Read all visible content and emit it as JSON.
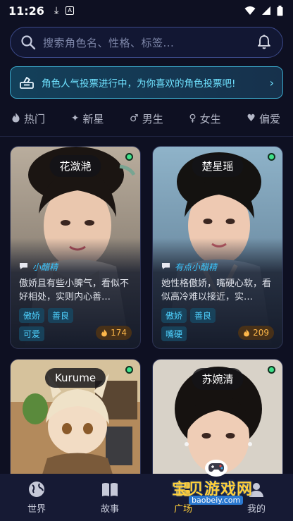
{
  "status_bar": {
    "time": "11:26"
  },
  "search": {
    "placeholder": "搜索角色名、性格、标签..."
  },
  "banner": {
    "text": "角色人气投票进行中，为你喜欢的角色投票吧!",
    "arrow": "›"
  },
  "filters": [
    {
      "label": "热门",
      "icon": "flame-icon",
      "glyph": "🔥︎"
    },
    {
      "label": "新星",
      "icon": "sparkle-icon",
      "glyph": "✦"
    },
    {
      "label": "男生",
      "icon": "male-icon",
      "glyph": "♂"
    },
    {
      "label": "女生",
      "icon": "female-icon",
      "glyph": "♀"
    },
    {
      "label": "偏爱",
      "icon": "heart-icon",
      "glyph": "♥"
    }
  ],
  "cards": [
    {
      "name": "花潋滟",
      "quote": "小醋精",
      "desc": "傲娇且有些小脾气，看似不好相处，实则内心善…",
      "tags": [
        "傲娇",
        "善良",
        "可爱"
      ],
      "heat": "174"
    },
    {
      "name": "楚星瑶",
      "quote": "有点小醋精",
      "desc": "她性格傲娇，嘴硬心软，看似高冷难以接近，实…",
      "tags": [
        "傲娇",
        "善良",
        "嘴硬"
      ],
      "heat": "209"
    },
    {
      "name": "Kurume"
    },
    {
      "name": "苏婉清"
    }
  ],
  "nav": [
    {
      "label": "世界",
      "icon": "globe-icon"
    },
    {
      "label": "故事",
      "icon": "book-icon"
    },
    {
      "label": "广场",
      "icon": "plaza-icon"
    },
    {
      "label": "我的",
      "icon": "profile-icon"
    }
  ],
  "watermark": {
    "main": "宝贝游戏网",
    "sub": "baobeiy.com"
  },
  "colors": {
    "background": "#0e1022",
    "accent_cyan": "#4fd2ff",
    "active_nav": "#ffcf3a",
    "online": "#3ee28a",
    "heat": "#ffb84a"
  }
}
